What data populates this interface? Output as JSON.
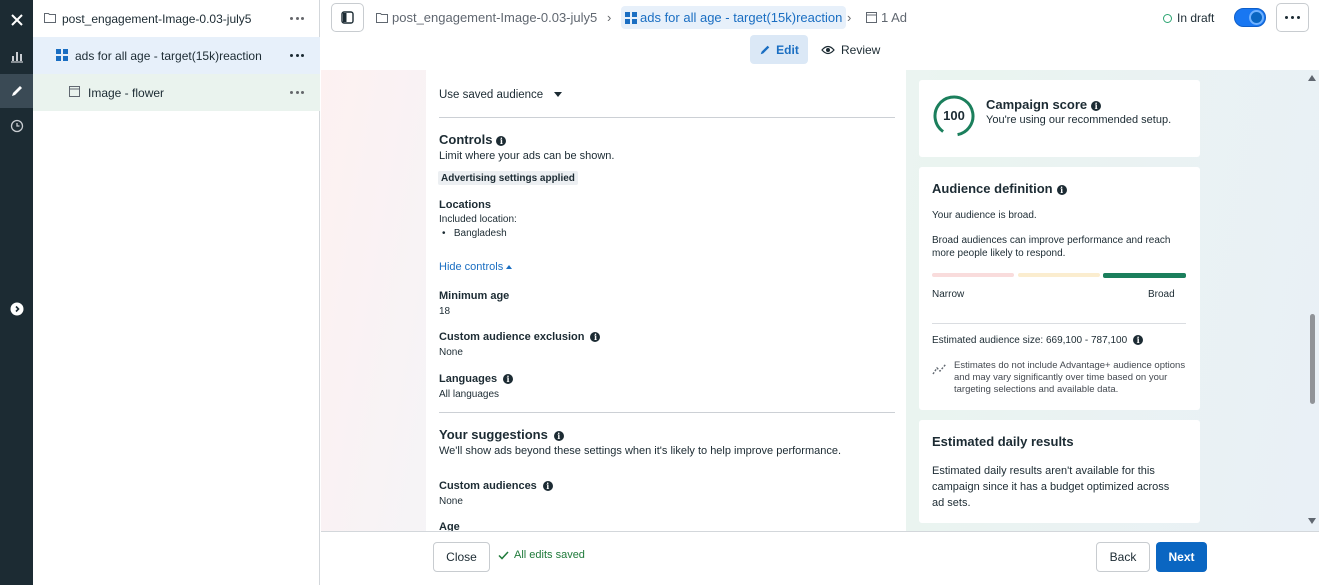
{
  "tree": {
    "campaign": "post_engagement-Image-0.03-july5",
    "ad_set": "ads for all age - target(15k)reaction",
    "ad": "Image - flower"
  },
  "header": {
    "crumb_campaign": "post_engagement-Image-0.03-july5",
    "crumb_adset": "ads for all age - target(15k)reaction",
    "crumb_ad": "1 Ad",
    "status": "In draft",
    "tab_edit": "Edit",
    "tab_review": "Review"
  },
  "form": {
    "saved_audience_label": "Use saved audience",
    "controls_title": "Controls",
    "controls_desc": "Limit where your ads can be shown.",
    "controls_badge": "Advertising settings applied",
    "locations_title": "Locations",
    "locations_included": "Included location:",
    "location_item": "Bangladesh",
    "hide_controls": "Hide controls",
    "min_age_title": "Minimum age",
    "min_age_value": "18",
    "exclusion_title": "Custom audience exclusion",
    "exclusion_value": "None",
    "languages_title": "Languages",
    "languages_value": "All languages",
    "suggestions_title": "Your suggestions",
    "suggestions_desc": "We'll show ads beyond these settings when it's likely to help improve performance.",
    "custom_aud_title": "Custom audiences",
    "custom_aud_value": "None",
    "age_title": "Age"
  },
  "score_card": {
    "score": "100",
    "title": "Campaign score",
    "subtitle": "You're using our recommended setup.",
    "accent": "#1b7f5c"
  },
  "audience_card": {
    "title": "Audience definition",
    "broad_text": "Your audience is broad.",
    "broad_desc": "Broad audiences can improve performance and reach more people likely to respond.",
    "narrow_label": "Narrow",
    "broad_label": "Broad",
    "size_text": "Estimated audience size: 669,100 - 787,100",
    "note": "Estimates do not include Advantage+ audience options and may vary significantly over time based on your targeting selections and available data."
  },
  "results_card": {
    "title": "Estimated daily results",
    "desc": "Estimated daily results aren't available for this campaign since it has a budget optimized across ad sets."
  },
  "footer": {
    "close": "Close",
    "saved": "All edits saved",
    "back": "Back",
    "next": "Next"
  }
}
